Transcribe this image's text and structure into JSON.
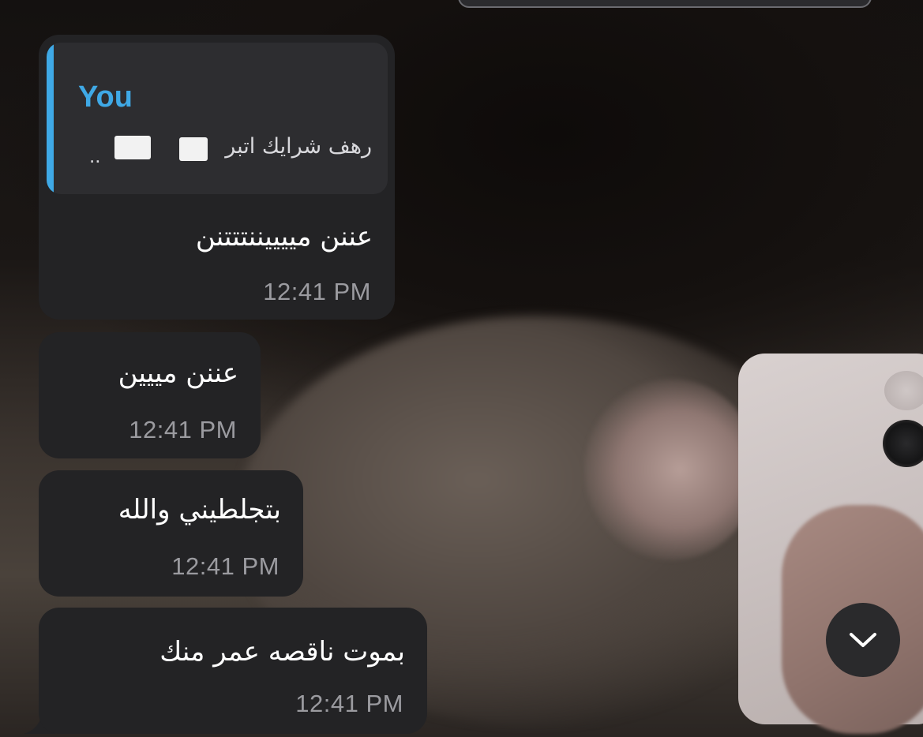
{
  "reply_preview": {
    "sender": "You",
    "text": "رهف شرايك اتبر"
  },
  "messages": [
    {
      "text": "عننن مييييننتتتنن",
      "time": "12:41 PM"
    },
    {
      "text": "عننن مييين",
      "time": "12:41 PM"
    },
    {
      "text": "بتجلطيني والله",
      "time": "12:41 PM"
    },
    {
      "text": "بموت ناقصه عمر منك",
      "time": "12:41 PM"
    }
  ],
  "icons": {
    "scroll_down": "chevron-down-icon"
  },
  "colors": {
    "bubble": "#232325",
    "reply_accent": "#3fa9e6",
    "timestamp": "#9b9ba0"
  }
}
